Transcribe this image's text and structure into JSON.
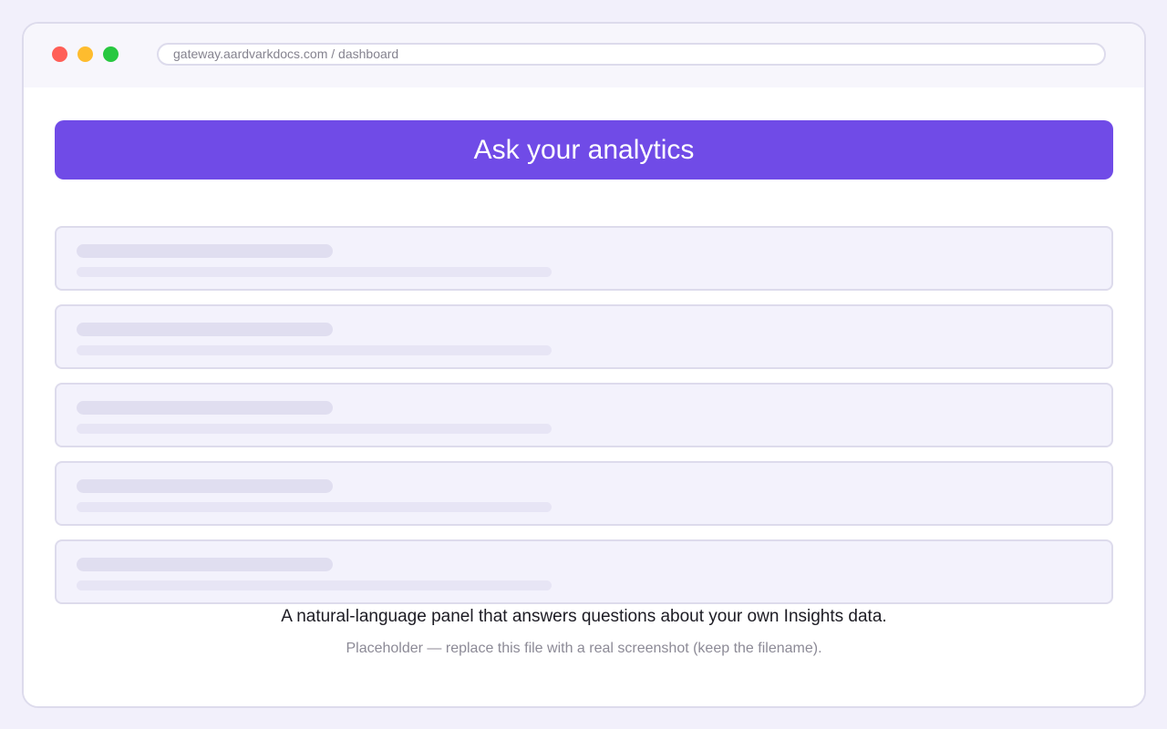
{
  "browser": {
    "url": "gateway.aardvarkdocs.com / dashboard",
    "controls": {
      "close_color": "#ff5f57",
      "minimize_color": "#febc2e",
      "maximize_color": "#28c840"
    }
  },
  "hero": {
    "title": "Ask your analytics",
    "color": "#704be7"
  },
  "placeholder_cards_count": 5,
  "caption": {
    "text": "A natural-language panel that answers questions about your own Insights data.",
    "note": "Placeholder — replace this file with a real screenshot (keep the filename)."
  }
}
